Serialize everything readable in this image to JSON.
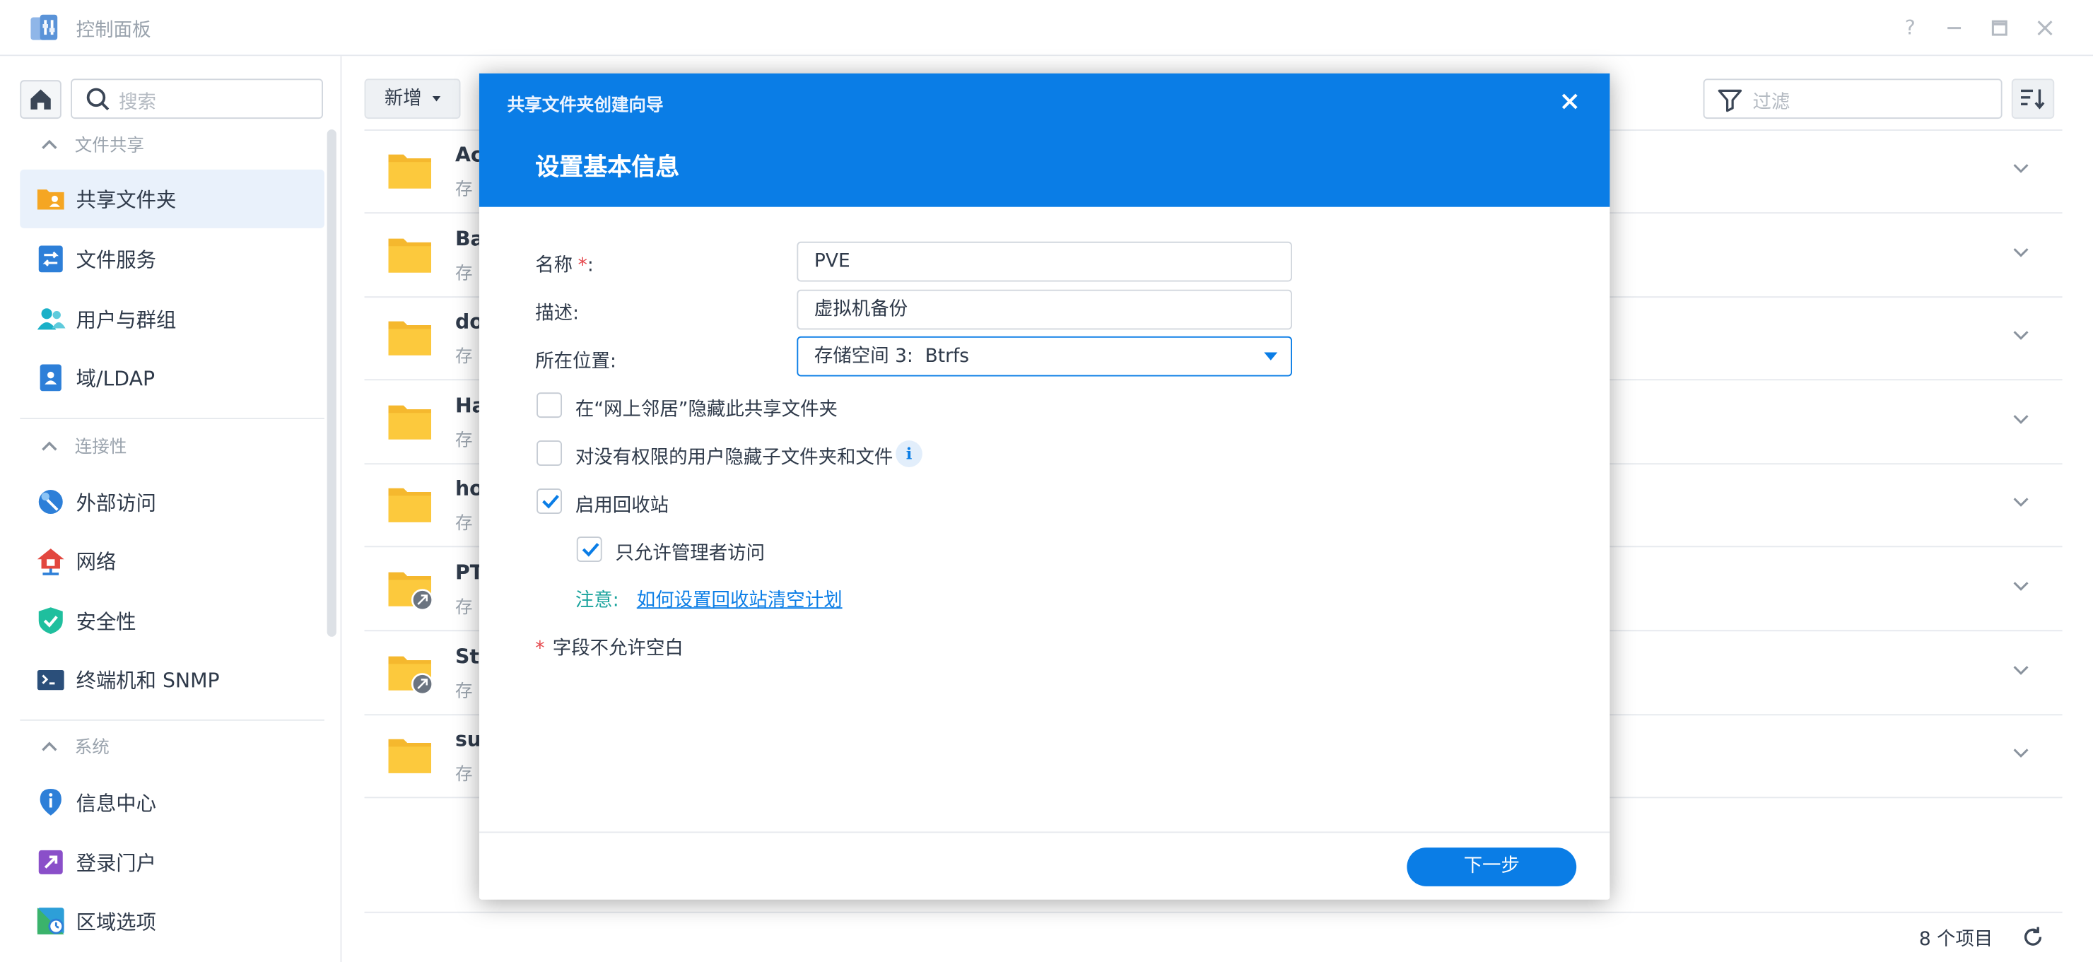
{
  "window": {
    "title": "控制面板",
    "help_icon": "question-icon",
    "controls": [
      "minimize-icon",
      "maximize-icon",
      "close-icon"
    ]
  },
  "sidebar": {
    "search_placeholder": "搜索",
    "sections": [
      {
        "title": "文件共享",
        "items": [
          {
            "label": "共享文件夹",
            "icon": "shared-folder-icon",
            "active": true
          },
          {
            "label": "文件服务",
            "icon": "file-services-icon"
          },
          {
            "label": "用户与群组",
            "icon": "users-icon"
          },
          {
            "label": "域/LDAP",
            "icon": "domain-ldap-icon"
          }
        ]
      },
      {
        "title": "连接性",
        "items": [
          {
            "label": "外部访问",
            "icon": "external-access-icon"
          },
          {
            "label": "网络",
            "icon": "network-icon"
          },
          {
            "label": "安全性",
            "icon": "security-shield-icon"
          },
          {
            "label": "终端机和 SNMP",
            "icon": "terminal-icon"
          }
        ]
      },
      {
        "title": "系统",
        "items": [
          {
            "label": "信息中心",
            "icon": "info-center-icon"
          },
          {
            "label": "登录门户",
            "icon": "login-portal-icon"
          },
          {
            "label": "区域选项",
            "icon": "regional-options-icon"
          }
        ]
      }
    ]
  },
  "toolbar": {
    "new_label": "新增",
    "filter_placeholder": "过滤"
  },
  "folders": [
    {
      "name": "Ac",
      "sub": "存",
      "badge": false
    },
    {
      "name": "Ba",
      "sub": "存",
      "badge": false
    },
    {
      "name": "do",
      "sub": "存",
      "badge": false
    },
    {
      "name": "Ha",
      "sub": "存",
      "badge": false
    },
    {
      "name": "ho",
      "sub": "存",
      "badge": false
    },
    {
      "name": "PT",
      "sub": "存",
      "badge": true
    },
    {
      "name": "St",
      "sub": "存",
      "badge": true
    },
    {
      "name": "su",
      "sub": "存",
      "badge": false
    }
  ],
  "footer": {
    "count": "8 个项目"
  },
  "dialog": {
    "wizard_title": "共享文件夹创建向导",
    "step_title": "设置基本信息",
    "name_label": "名称",
    "name_required": "*",
    "name_colon": ":",
    "name_value": "PVE",
    "desc_label": "描述:",
    "desc_value": "虚拟机备份",
    "location_label": "所在位置:",
    "location_value": "存储空间 3:  Btrfs",
    "hide_network_label": "在“网上邻居”隐藏此共享文件夹",
    "hide_network_checked": false,
    "hide_subfolders_label": "对没有权限的用户隐藏子文件夹和文件",
    "hide_subfolders_checked": false,
    "recycle_label": "启用回收站",
    "recycle_checked": true,
    "admin_only_label": "只允许管理者访问",
    "admin_only_checked": true,
    "note_label": "注意:",
    "note_link": "如何设置回收站清空计划",
    "required_note": "字段不允许空白",
    "required_mark": "*",
    "next_label": "下一步",
    "accent_color": "#0a7de6"
  }
}
